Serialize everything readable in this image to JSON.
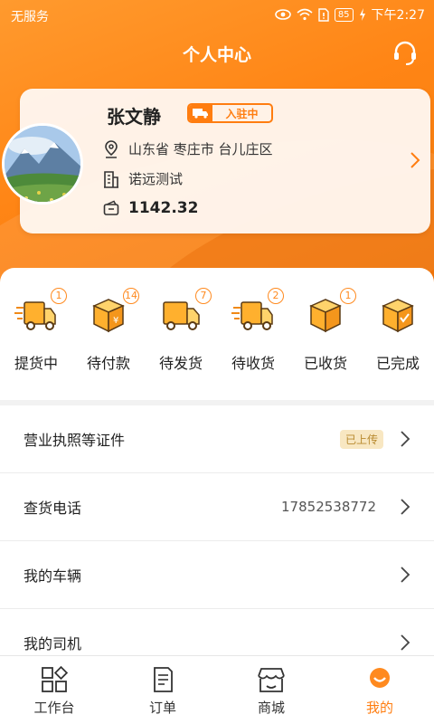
{
  "status_bar": {
    "carrier": "无服务",
    "battery": "85",
    "time": "下午2:27"
  },
  "header": {
    "title": "个人中心"
  },
  "profile": {
    "name": "张文静",
    "badge": "入驻中",
    "location": "山东省 枣庄市 台儿庄区",
    "company": "诺远测试",
    "balance": "1142.32"
  },
  "orders": [
    {
      "label": "提货中",
      "count": "1",
      "icon": "delivery-truck-icon"
    },
    {
      "label": "待付款",
      "count": "14",
      "icon": "box-payment-icon"
    },
    {
      "label": "待发货",
      "count": "7",
      "icon": "truck-icon"
    },
    {
      "label": "待收货",
      "count": "2",
      "icon": "delivery-truck-icon"
    },
    {
      "label": "已收货",
      "count": "1",
      "icon": "box-icon"
    },
    {
      "label": "已完成",
      "count": "",
      "icon": "box-check-icon"
    }
  ],
  "menu": [
    {
      "label": "营业执照等证件",
      "tag": "已上传",
      "value": ""
    },
    {
      "label": "查货电话",
      "tag": "",
      "value": "17852538772"
    },
    {
      "label": "我的车辆",
      "tag": "",
      "value": ""
    },
    {
      "label": "我的司机",
      "tag": "",
      "value": ""
    }
  ],
  "tabs": [
    {
      "label": "工作台",
      "icon": "grid-icon"
    },
    {
      "label": "订单",
      "icon": "document-icon"
    },
    {
      "label": "商城",
      "icon": "store-icon"
    },
    {
      "label": "我的",
      "icon": "user-icon"
    }
  ],
  "colors": {
    "accent": "#ff7d10",
    "accent_light": "#ff9a2e",
    "tag_bg": "#f8e7c2",
    "tag_text": "#b88a2f"
  }
}
